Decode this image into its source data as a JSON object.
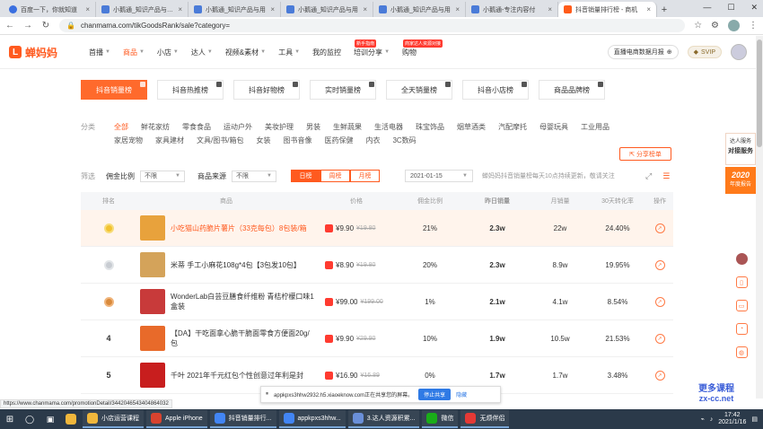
{
  "browser": {
    "tabs": [
      {
        "title": "百度一下，你就知道",
        "fav": "paw"
      },
      {
        "title": "小鹅通_知识产品与用户",
        "fav": "blue"
      },
      {
        "title": "小鹅通_知识产品与用",
        "fav": "blue"
      },
      {
        "title": "小鹅通_知识产品与用",
        "fav": "blue"
      },
      {
        "title": "小鹅通_知识产品与用",
        "fav": "blue"
      },
      {
        "title": "小鹅通-专注内容付",
        "fav": "blue"
      },
      {
        "title": "抖音销量排行榜 - 商机",
        "fav": "orange",
        "active": true
      }
    ],
    "new_tab": "+",
    "url": "chanmama.com/tikGoodsRank/sale?category=",
    "status_url": "https://www.chanmama.com/promotionDetail/3442046543404864032"
  },
  "site": {
    "logo_text": "蝉妈妈",
    "nav": [
      {
        "label": "首播",
        "caret": true
      },
      {
        "label": "商品",
        "caret": true,
        "active": true
      },
      {
        "label": "小店",
        "caret": true
      },
      {
        "label": "达人",
        "caret": true
      },
      {
        "label": "视频&素材",
        "caret": true
      },
      {
        "label": "工具",
        "caret": true
      },
      {
        "label": "我的监控",
        "caret": false
      },
      {
        "label": "培训分享",
        "caret": true,
        "badge": "新手指南"
      },
      {
        "label": "购物",
        "caret": false,
        "badge": "商家达人资源对接"
      }
    ],
    "live_button": "直播电商数据月报",
    "svip": "SVIP"
  },
  "rank_tabs": [
    "抖音销量榜",
    "抖音热推榜",
    "抖音好物榜",
    "实时销量榜",
    "全天销量榜",
    "抖音小店榜",
    "商品品牌榜"
  ],
  "categories": {
    "label": "分类",
    "items": [
      "全部",
      "鲜花家纺",
      "零食食品",
      "运动户外",
      "美妆护理",
      "男装",
      "生鲜蔬果",
      "生活电器",
      "珠宝饰品",
      "烟草酒类",
      "汽配摩托",
      "母婴玩具",
      "工业用品",
      "家居宠物",
      "家具建材",
      "文具/图书/箱包",
      "女装",
      "图书音像",
      "医药保健",
      "内衣",
      "3C数码"
    ],
    "share_button": "分享榜单"
  },
  "filters": {
    "label": "筛选",
    "commission_label": "佣金比例",
    "commission_value": "不限",
    "source_label": "商品来源",
    "source_value": "不限",
    "period": [
      "日榜",
      "周榜",
      "月榜"
    ],
    "date": "2021-01-15",
    "note": "蝉妈妈抖音销量榜每天10点持续更新，敬请关注"
  },
  "table": {
    "headers": [
      "排名",
      "商品",
      "价格",
      "佣金比例",
      "昨日销量",
      "月销量",
      "30天转化率",
      "操作"
    ],
    "rows": [
      {
        "rank": "",
        "medal": "gold",
        "name": "小吃猫山药脆片薯片（33克每包）8包装/箱",
        "price": "¥9.90",
        "orig": "¥19.80",
        "commission": "21%",
        "yesterday": "2.3w",
        "monthly": "22w",
        "conversion": "24.40%",
        "thumb": "#e8a23c"
      },
      {
        "rank": "",
        "medal": "silver",
        "name": "米蒂 手工小麻花108g*4包【3包发10包】",
        "price": "¥8.90",
        "orig": "¥19.80",
        "commission": "20%",
        "yesterday": "2.3w",
        "monthly": "8.9w",
        "conversion": "19.95%",
        "thumb": "#d4a35a"
      },
      {
        "rank": "",
        "medal": "bronze",
        "name": "WonderLab白芸豆膳食纤维粉 青桔柠檬口味1盒装",
        "price": "¥99.00",
        "orig": "¥199.00",
        "commission": "1%",
        "yesterday": "2.1w",
        "monthly": "4.1w",
        "conversion": "8.54%",
        "thumb": "#c83a3a"
      },
      {
        "rank": "4",
        "medal": "",
        "name": "【DA】干吃面拿心脆干脆面零食方便面20g/包",
        "price": "¥9.90",
        "orig": "¥29.90",
        "commission": "10%",
        "yesterday": "1.9w",
        "monthly": "10.5w",
        "conversion": "21.53%",
        "thumb": "#e86a2a"
      },
      {
        "rank": "5",
        "medal": "",
        "name": "千叶 2021年千元红包个性创意过年利是封",
        "price": "¥16.90",
        "orig": "¥16.89",
        "commission": "0%",
        "yesterday": "1.7w",
        "monthly": "1.7w",
        "conversion": "3.48%",
        "thumb": "#c81e1e"
      }
    ]
  },
  "side": {
    "service_top": "达人服务",
    "service_main": "对接服务",
    "promo_year": "2020",
    "promo_text": "年度报告"
  },
  "share_bar": {
    "text": "appkpxs3hhw2932.h5.xiaoeknow.com正在共享您的屏幕。",
    "stop": "停止共享",
    "hide": "隐藏"
  },
  "watermark": {
    "line1": "更多课程",
    "line2": "zx-cc.net"
  },
  "taskbar": {
    "items": [
      {
        "label": "小店运营课程",
        "color": "#f0b73c"
      },
      {
        "label": "Apple iPhone",
        "color": "#d8432f"
      },
      {
        "label": "抖音销量排行...",
        "color": "#4285f4"
      },
      {
        "label": "appkpxs3hhw...",
        "color": "#4285f4"
      },
      {
        "label": "3.达人资源积累...",
        "color": "#6a8fd8"
      },
      {
        "label": "微信",
        "color": "#1aad19"
      },
      {
        "label": "无烦伴侣",
        "color": "#e53935"
      }
    ],
    "time": "17:42",
    "date": "2021/1/16"
  }
}
